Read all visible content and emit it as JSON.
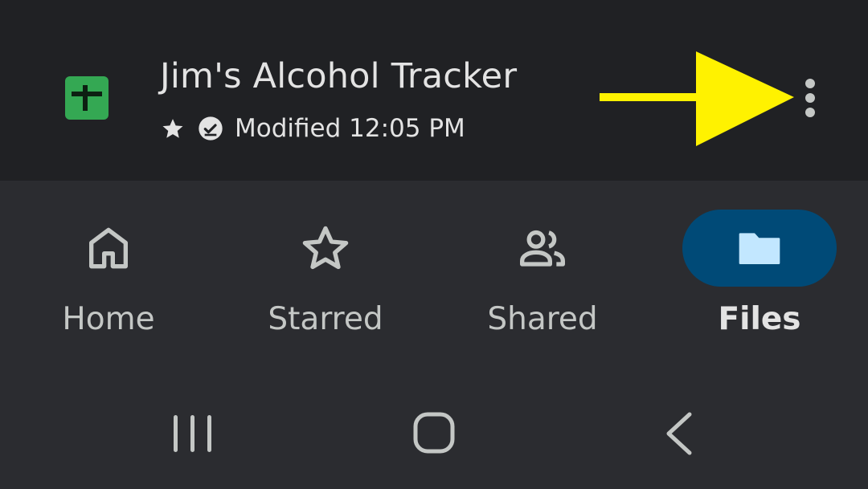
{
  "file": {
    "title": "Jim's Alcohol Tracker",
    "modified": "Modified 12:05 PM",
    "icon": "google-sheets-icon",
    "starred": true,
    "available_offline": true
  },
  "annotation": {
    "type": "arrow",
    "color": "#fff200",
    "points_to": "more-options-button"
  },
  "nav": {
    "items": [
      {
        "label": "Home",
        "icon": "home-icon",
        "active": false
      },
      {
        "label": "Starred",
        "icon": "star-outline-icon",
        "active": false
      },
      {
        "label": "Shared",
        "icon": "people-icon",
        "active": false
      },
      {
        "label": "Files",
        "icon": "folder-icon",
        "active": true
      }
    ]
  },
  "system_nav": [
    "recents-icon",
    "home-circle-icon",
    "back-icon"
  ],
  "colors": {
    "header_bg": "#202124",
    "nav_bg": "#2b2c30",
    "sheets_green": "#34a853",
    "active_pill": "#004a77",
    "active_folder": "#c2e7ff"
  }
}
